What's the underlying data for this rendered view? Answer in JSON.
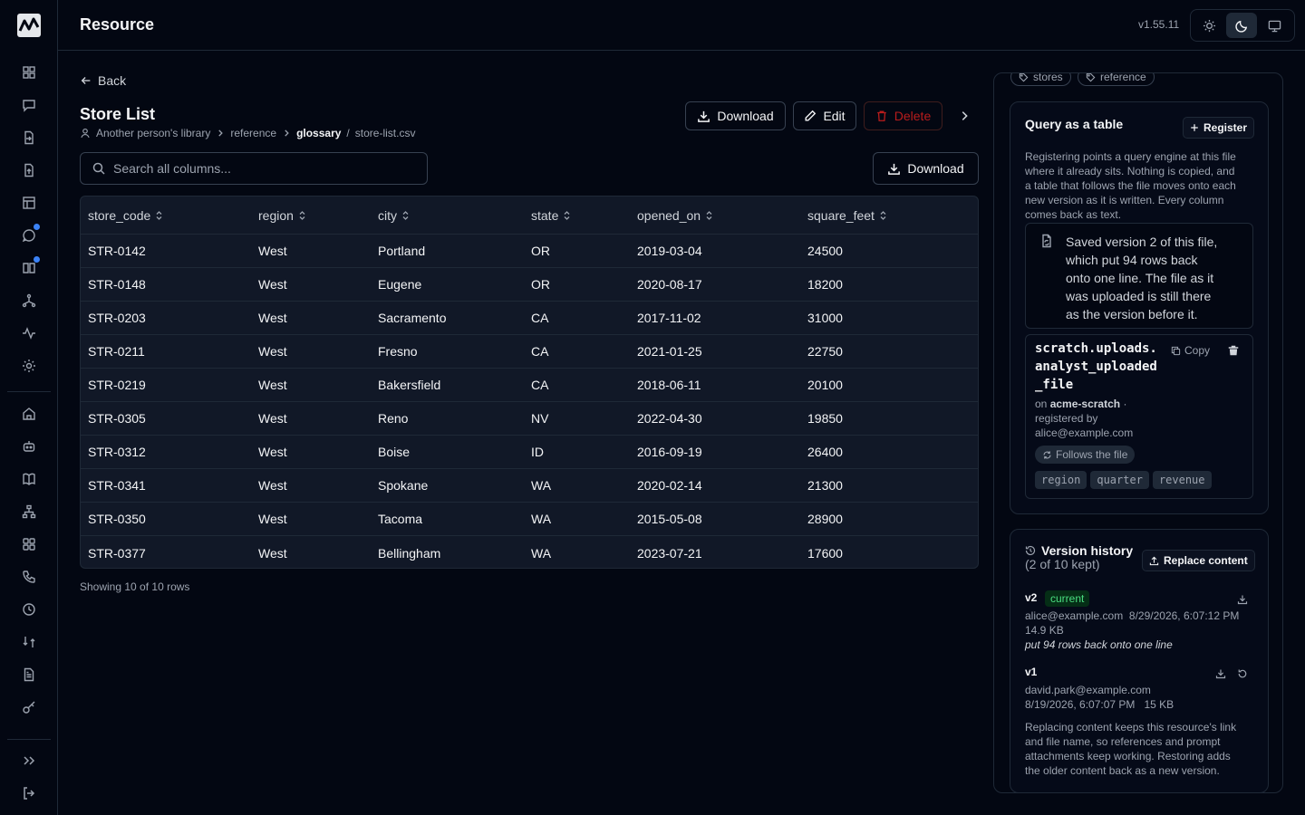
{
  "app": {
    "title": "Resource",
    "version": "v1.55.11"
  },
  "sidebar": {
    "items": [
      {
        "name": "dashboard-icon"
      },
      {
        "name": "chat-icon"
      },
      {
        "name": "file-import-icon"
      },
      {
        "name": "file-upload-icon"
      },
      {
        "name": "table-icon"
      },
      {
        "name": "message-icon",
        "badge": true
      },
      {
        "name": "book-icon",
        "badge": true
      },
      {
        "name": "network-icon"
      },
      {
        "name": "activity-icon"
      },
      {
        "name": "settings-icon"
      },
      {
        "name": "home-icon"
      },
      {
        "name": "bot-icon"
      },
      {
        "name": "library-icon"
      },
      {
        "name": "hierarchy-icon"
      },
      {
        "name": "apps-icon"
      },
      {
        "name": "phone-icon"
      },
      {
        "name": "clock-icon"
      },
      {
        "name": "compare-icon"
      },
      {
        "name": "document-icon"
      },
      {
        "name": "key-icon"
      }
    ],
    "expand_icon": "chevrons-right-icon",
    "logout_icon": "logout-icon"
  },
  "theme_switch": [
    "sun-icon",
    "moon-icon",
    "monitor-icon"
  ],
  "header": {
    "back_label": "Back",
    "title": "Store List",
    "breadcrumb": {
      "owner": "Another person's library",
      "folder": "reference",
      "subfolder": "glossary",
      "separator": "/",
      "file": "store-list.csv"
    },
    "actions": {
      "download": "Download",
      "edit": "Edit",
      "delete": "Delete"
    }
  },
  "search": {
    "placeholder": "Search all columns..."
  },
  "toolbar": {
    "download": "Download"
  },
  "table": {
    "columns": [
      "store_code",
      "region",
      "city",
      "state",
      "opened_on",
      "square_feet"
    ],
    "rows": [
      [
        "STR-0142",
        "West",
        "Portland",
        "OR",
        "2019-03-04",
        "24500"
      ],
      [
        "STR-0148",
        "West",
        "Eugene",
        "OR",
        "2020-08-17",
        "18200"
      ],
      [
        "STR-0203",
        "West",
        "Sacramento",
        "CA",
        "2017-11-02",
        "31000"
      ],
      [
        "STR-0211",
        "West",
        "Fresno",
        "CA",
        "2021-01-25",
        "22750"
      ],
      [
        "STR-0219",
        "West",
        "Bakersfield",
        "CA",
        "2018-06-11",
        "20100"
      ],
      [
        "STR-0305",
        "West",
        "Reno",
        "NV",
        "2022-04-30",
        "19850"
      ],
      [
        "STR-0312",
        "West",
        "Boise",
        "ID",
        "2016-09-19",
        "26400"
      ],
      [
        "STR-0341",
        "West",
        "Spokane",
        "WA",
        "2020-02-14",
        "21300"
      ],
      [
        "STR-0350",
        "West",
        "Tacoma",
        "WA",
        "2015-05-08",
        "28900"
      ],
      [
        "STR-0377",
        "West",
        "Bellingham",
        "WA",
        "2023-07-21",
        "17600"
      ]
    ],
    "footer": "Showing 10 of 10 rows"
  },
  "panel": {
    "tags": [
      "stores",
      "reference"
    ],
    "query": {
      "title": "Query as a table",
      "register_label": "Register",
      "description_lines": [
        "Registering points a query engine at this file",
        "where it already sits. Nothing is copied, and",
        "a table that follows the file moves onto each",
        "new version as it is written. Every column",
        "comes back as text."
      ],
      "notice_lines": [
        "Saved version 2 of this file,",
        "which put 94 rows back",
        "onto one line. The file as it",
        "was uploaded is still there",
        "as the version before it."
      ],
      "table_name_lines": [
        "scratch.uploads.",
        "analyst_uploaded",
        "_file"
      ],
      "copy_label": "Copy",
      "on_prefix": "on",
      "engine": "acme-scratch",
      "engine_suffix": "·",
      "registered_by_label": "registered by",
      "registered_by": "alice@example.com",
      "follows_label": "Follows the file",
      "columns": [
        "region",
        "quarter",
        "revenue"
      ]
    },
    "history": {
      "title": "Version history",
      "subtitle": "(2 of 10 kept)",
      "replace_label": "Replace content",
      "versions": [
        {
          "label": "v2",
          "badge": "current",
          "author": "alice@example.com",
          "date": "8/29/2026, 6:07:12 PM",
          "size": "14.9 KB",
          "note": "put 94 rows back onto one line"
        },
        {
          "label": "v1",
          "author": "david.park@example.com",
          "date": "8/19/2026, 6:07:07 PM",
          "size": "15 KB"
        }
      ],
      "footer_lines": [
        "Replacing content keeps this resource's link",
        "and file name, so references and prompt",
        "attachments keep working. Restoring adds",
        "the older content back as a new version."
      ]
    }
  }
}
